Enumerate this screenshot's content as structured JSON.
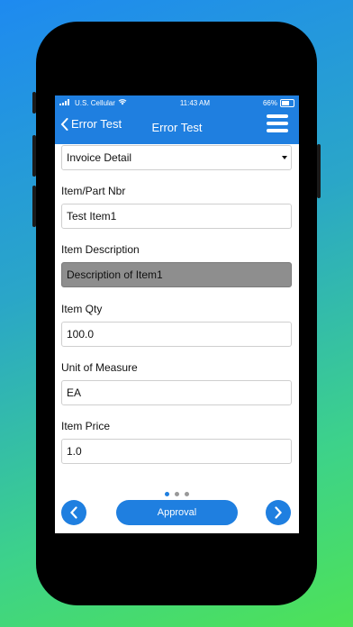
{
  "status_bar": {
    "carrier": "U.S. Cellular",
    "time": "11:43 AM",
    "battery": "66%"
  },
  "nav": {
    "back_label": "Error Test",
    "title": "Error Test"
  },
  "section_select": {
    "value": "Invoice Detail"
  },
  "fields": [
    {
      "label": "Item/Part Nbr",
      "value": "Test Item1",
      "disabled": false
    },
    {
      "label": "Item Description",
      "value": "Description of Item1",
      "disabled": true
    },
    {
      "label": "Item Qty",
      "value": "100.0",
      "disabled": false
    },
    {
      "label": "Unit of Measure",
      "value": "EA",
      "disabled": false
    },
    {
      "label": "Item Price",
      "value": "1.0",
      "disabled": false
    }
  ],
  "pager": {
    "count": 3,
    "active": 1
  },
  "footer": {
    "approval_label": "Approval"
  },
  "colors": {
    "accent": "#1f7fe0",
    "disabled_field": "#8e8e8e"
  }
}
